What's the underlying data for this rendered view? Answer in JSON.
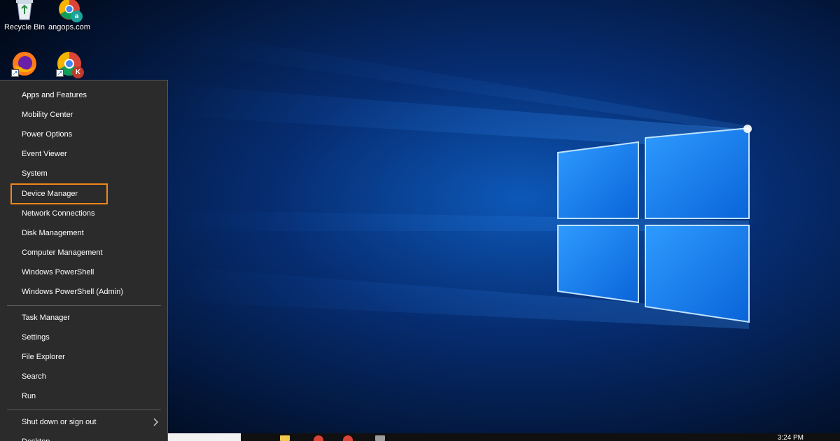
{
  "desktop": {
    "icons": [
      {
        "label": "Recycle Bin",
        "icon": "recycle-bin-icon"
      },
      {
        "label": "angops.com",
        "icon": "chrome-profile-icon",
        "badge": "a"
      },
      {
        "label": "",
        "icon": "firefox-icon"
      },
      {
        "label": "",
        "icon": "chrome-profile-icon",
        "badge": "K"
      }
    ]
  },
  "winx_menu": {
    "items": [
      {
        "label": "Apps and Features"
      },
      {
        "label": "Mobility Center"
      },
      {
        "label": "Power Options"
      },
      {
        "label": "Event Viewer"
      },
      {
        "label": "System"
      },
      {
        "label": "Device Manager",
        "highlighted": true
      },
      {
        "label": "Network Connections"
      },
      {
        "label": "Disk Management"
      },
      {
        "label": "Computer Management"
      },
      {
        "label": "Windows PowerShell"
      },
      {
        "label": "Windows PowerShell (Admin)"
      },
      {
        "label": "Task Manager"
      },
      {
        "label": "Settings"
      },
      {
        "label": "File Explorer"
      },
      {
        "label": "Search"
      },
      {
        "label": "Run"
      },
      {
        "label": "Shut down or sign out",
        "submenu": true
      },
      {
        "label": "Desktop"
      }
    ],
    "highlight_color": "#f0871a",
    "background_color": "#2b2b2b"
  },
  "taskbar": {
    "clock": "3:24 PM",
    "icons": [
      "file-explorer-icon",
      "chrome-icon",
      "chrome-icon",
      "app-icon"
    ]
  },
  "colors": {
    "wallpaper_blue": "#1f7fe0",
    "wallpaper_dark": "#020a1e"
  }
}
